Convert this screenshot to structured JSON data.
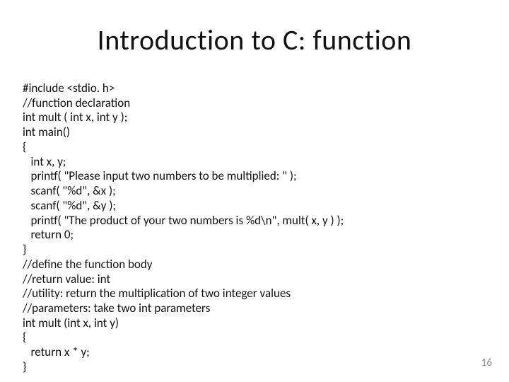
{
  "slide": {
    "title": "Introduction to C: function",
    "code_lines": [
      "#include <stdio. h>",
      "//function declaration",
      "int mult ( int x, int y );",
      "int main()",
      "{",
      "   int x, y;",
      "   printf( \"Please input two numbers to be multiplied: \" );",
      "   scanf( \"%d\", &x );",
      "   scanf( \"%d\", &y );",
      "   printf( \"The product of your two numbers is %d\\n\", mult( x, y ) );",
      "   return 0;",
      "}",
      "//define the function body",
      "//return value: int",
      "//utility: return the multiplication of two integer values",
      "//parameters: take two int parameters",
      "int mult (int x, int y)",
      "{",
      "   return x * y;",
      "}"
    ],
    "page_number": "16"
  }
}
